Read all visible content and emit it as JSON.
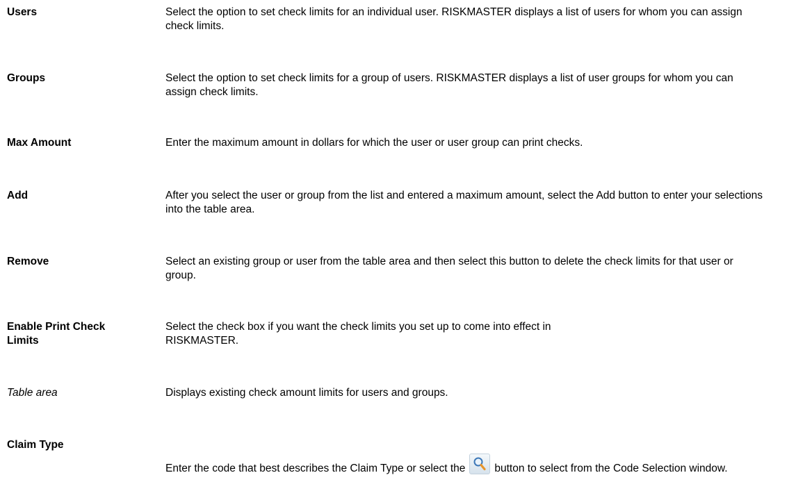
{
  "entries": [
    {
      "term": "Users",
      "desc": "Select the option to set check limits for an individual user. RISKMASTER displays a list of users for whom you can assign check limits."
    },
    {
      "term": "Groups",
      "desc": "Select the option to set check limits for a group of users. RISKMASTER displays a list of user groups for whom you can assign check limits."
    },
    {
      "term": "Max Amount",
      "desc": "Enter the maximum amount in dollars for which the user or user group can print checks."
    },
    {
      "term": "Add",
      "desc": "After you select the user or group from the list and entered a maximum amount, select the Add button to enter your selections into the table area."
    },
    {
      "term": "Remove",
      "desc": "Select an existing group or user from the table area and then select this button to delete the check limits for that user or group."
    },
    {
      "term": "Enable Print Check Limits",
      "desc": "Select the check box if you want the check limits you set up to come into effect in RISKMASTER."
    },
    {
      "term": "Table area",
      "desc": "Displays existing check amount limits for users and groups."
    },
    {
      "term": "Claim Type",
      "desc_before": "Enter the code that best describes the Claim Type or select the",
      "desc_after": "button to select from the Code Selection window.",
      "icon": "search-icon"
    }
  ]
}
